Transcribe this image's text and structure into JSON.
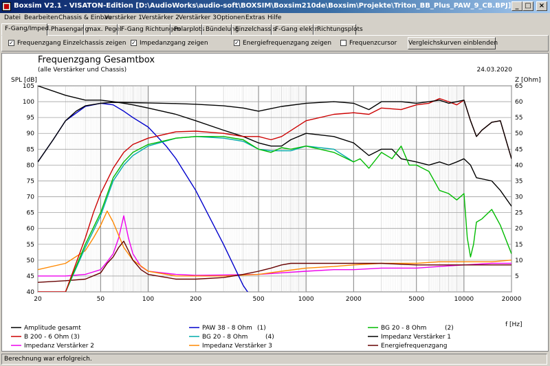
{
  "window": {
    "title": "Boxsim V2.1 - VISATON-Edition [D:\\AudioWorks\\audio-soft\\BOXSIM\\Boxsim210de\\Boxsim\\Projekte\\Triton_BB_Plus_PAW_9_CB.BPJ]",
    "min_icon": "minimize-icon",
    "max_icon": "maximize-icon",
    "close_icon": "close-icon",
    "min_glyph": "_",
    "max_glyph": "□",
    "close_glyph": "×"
  },
  "menu": [
    "Datei",
    "Bearbeiten",
    "Chassis & Einbau",
    "Verstärker 1",
    "Verstärker 2",
    "Verstärker 3",
    "Optionen",
    "Extras",
    "Hilfe"
  ],
  "tabs": [
    "F-Gang/Imped.",
    "Phasengang",
    "max. Pegel",
    "F-Gang Richtungen",
    "Polarplots",
    "Bündelung",
    "Einzelchassis",
    "F-Gang elektr.",
    "Richtungsplots"
  ],
  "options": {
    "check1": "Frequenzgang Einzelchassis zeigen",
    "check2": "Impedanzgang zeigen",
    "check3": "Energiefrequenzgang zeigen",
    "check4": "Frequenzcursor",
    "check_mark": "✓",
    "button": "Vergleichskurven einblenden"
  },
  "status": "Berechnung war erfolgreich.",
  "chart_data": {
    "type": "line",
    "title": "Frequenzgang Gesamtbox",
    "subtitle": "(alle Verstärker und Chassis)",
    "date": "24.03.2020",
    "ylabel": "SPL [dB]",
    "y2label": "Z [Ohm]",
    "xlabel": "f [Hz]",
    "xscale": "log",
    "xlim": [
      20,
      20000
    ],
    "ylim": [
      40,
      105
    ],
    "y2lim": [
      0,
      65
    ],
    "xticks": [
      "20",
      "50",
      "100",
      "200",
      "500",
      "1000",
      "2000",
      "5000",
      "10000",
      "20000"
    ],
    "yticks": [
      "40",
      "45",
      "50",
      "55",
      "60",
      "65",
      "70",
      "75",
      "80",
      "85",
      "90",
      "95",
      "100",
      "105"
    ],
    "y2ticks": [
      "5",
      "10",
      "15",
      "20",
      "25",
      "30",
      "35",
      "40",
      "45",
      "50",
      "55",
      "60",
      "65"
    ],
    "series": [
      {
        "name": "Amplitude gesamt",
        "color": "#000000",
        "axis": "left",
        "x": [
          20,
          25,
          30,
          35,
          40,
          50,
          60,
          80,
          100,
          150,
          200,
          300,
          400,
          500,
          700,
          1000,
          1500,
          2000,
          2500,
          3000,
          4000,
          5000,
          6000,
          7000,
          8000,
          9000,
          10000,
          11000,
          12000,
          13000,
          15000,
          17000,
          20000
        ],
        "y": [
          81,
          88,
          94,
          97,
          98.7,
          99.5,
          99.8,
          99.7,
          99.6,
          99.4,
          99.2,
          98.7,
          98,
          97,
          98.5,
          99.5,
          100,
          99.5,
          97.5,
          100,
          100,
          99.5,
          100,
          100.5,
          99.5,
          100,
          100.5,
          94,
          89,
          91,
          93.5,
          94,
          82
        ]
      },
      {
        "name": "B 200 - 6 Ohm (3)",
        "color": "#cc0000",
        "axis": "left",
        "x": [
          20,
          30,
          40,
          45,
          50,
          60,
          70,
          80,
          100,
          150,
          200,
          300,
          400,
          500,
          600,
          700,
          1000,
          1500,
          2000,
          2500,
          3000,
          4000,
          5000,
          6000,
          7000,
          8000,
          9000,
          10000,
          11000,
          12000,
          13000,
          15000,
          17000,
          20000
        ],
        "y": [
          40,
          40,
          57,
          65,
          71,
          79,
          84,
          86.5,
          88.5,
          90.5,
          90.7,
          90,
          89,
          89,
          88,
          89,
          94,
          96,
          96.5,
          96,
          98,
          97.5,
          99,
          99.5,
          101,
          100,
          99,
          100.5,
          94,
          89,
          91,
          93.5,
          94,
          82
        ]
      },
      {
        "name": "BG 20 - 8 Ohm (2)",
        "color": "#00bb00",
        "axis": "left",
        "x": [
          30,
          40,
          50,
          60,
          70,
          80,
          100,
          150,
          200,
          300,
          400,
          500,
          600,
          700,
          800,
          1000,
          1500,
          2000,
          2200,
          2500,
          3000,
          3500,
          4000,
          4500,
          5000,
          6000,
          7000,
          8000,
          9000,
          10000,
          10500,
          11000,
          11500,
          12000,
          13000,
          15000,
          17000,
          20000
        ],
        "y": [
          40,
          55,
          65,
          76,
          81,
          84,
          86.5,
          88.5,
          89,
          89,
          88,
          85,
          84,
          85.5,
          85,
          86,
          84,
          81,
          82,
          79,
          84,
          82,
          86,
          80,
          80,
          78,
          72,
          71,
          69,
          71,
          57,
          51,
          55,
          62,
          63,
          66,
          61,
          52
        ]
      },
      {
        "name": "BG 20 - 8 Ohm (4)",
        "color": "#00aaaa",
        "axis": "left",
        "x": [
          30,
          40,
          50,
          60,
          70,
          80,
          100,
          150,
          200,
          300,
          400,
          500,
          600,
          700,
          800,
          1000,
          1500,
          2000
        ],
        "y": [
          40,
          54,
          64,
          75,
          80,
          83,
          86,
          88.5,
          89,
          88.5,
          87.5,
          85,
          84.5,
          84.5,
          84.5,
          86,
          85,
          81
        ]
      },
      {
        "name": "PAW 38 - 8 Ohm (1)",
        "color": "#0000cc",
        "axis": "left",
        "x": [
          20,
          25,
          30,
          40,
          50,
          60,
          70,
          80,
          100,
          130,
          150,
          200,
          300,
          400,
          500
        ],
        "y": [
          81,
          88,
          94,
          98.5,
          99.5,
          99,
          97,
          95,
          92,
          86,
          82,
          72,
          55,
          42,
          35
        ]
      },
      {
        "name": "Impedanz Verstärker 1",
        "color": "#000000",
        "axis": "right",
        "x": [
          20,
          30,
          40,
          50,
          60,
          70,
          80,
          100,
          150,
          200,
          300,
          400,
          500,
          600,
          700,
          800,
          1000,
          1500,
          2000,
          2500,
          3000,
          3500,
          4000,
          5000,
          6000,
          7000,
          8000,
          9000,
          10000,
          11000,
          12000,
          15000,
          17000,
          20000
        ],
        "y": [
          65,
          62,
          60.5,
          60.5,
          60,
          59.5,
          59,
          58,
          56,
          54,
          51,
          49,
          47,
          46,
          46,
          48,
          50,
          49,
          47,
          43,
          45,
          45,
          42,
          41,
          40,
          41,
          40,
          41,
          42,
          40,
          36,
          35,
          32,
          27
        ]
      },
      {
        "name": "Impedanz Verstärker 2",
        "color": "#ee00ee",
        "axis": "right",
        "x": [
          20,
          30,
          40,
          50,
          55,
          60,
          65,
          70,
          75,
          80,
          90,
          100,
          150,
          200,
          300,
          500,
          700,
          1000,
          1500,
          2000,
          3000,
          5000,
          7000,
          10000,
          15000,
          20000
        ],
        "y": [
          5,
          5,
          5.5,
          7,
          9.5,
          12,
          17,
          24,
          17,
          12,
          8,
          6.5,
          5.5,
          5.2,
          5.3,
          5.5,
          6,
          6.5,
          7,
          7,
          7.5,
          7.5,
          8,
          8.5,
          9,
          9
        ]
      },
      {
        "name": "Impedanz Verstärker 3",
        "color": "#ff8800",
        "axis": "right",
        "x": [
          20,
          30,
          40,
          45,
          50,
          55,
          60,
          70,
          80,
          100,
          150,
          200,
          300,
          500,
          700,
          1000,
          1500,
          2000,
          3000,
          5000,
          7000,
          10000,
          15000,
          20000
        ],
        "y": [
          7,
          9,
          13,
          17,
          21,
          25.5,
          22,
          14,
          10,
          6.5,
          5,
          5,
          5,
          5.5,
          6.5,
          7.5,
          8,
          8.5,
          9,
          9,
          9.5,
          9.5,
          9.5,
          10
        ]
      },
      {
        "name": "Energiefrequenzgang",
        "color": "#660000",
        "axis": "right",
        "x": [
          20,
          30,
          40,
          50,
          55,
          60,
          65,
          70,
          75,
          80,
          90,
          100,
          150,
          200,
          300,
          400,
          500,
          600,
          700,
          800,
          1000,
          1500,
          2000,
          3000,
          5000,
          7000,
          10000,
          15000,
          20000
        ],
        "y": [
          3,
          3.5,
          4,
          6,
          9,
          11,
          14,
          16,
          13,
          10,
          7,
          5.5,
          4,
          4,
          4.5,
          5.5,
          6.5,
          7.5,
          8.5,
          9,
          9,
          9,
          9,
          9,
          8.5,
          8.5,
          8.5,
          8.5,
          8.5
        ]
      }
    ]
  },
  "legend_rows": [
    [
      "Amplitude gesamt",
      "PAW 38 - 8 Ohm",
      "(1)",
      "BG 20 - 8 Ohm",
      "(2)"
    ],
    [
      "B 200 - 6 Ohm (3)",
      "BG 20 - 8 Ohm",
      "(4)",
      "Impedanz Verstärker 1"
    ],
    [
      "Impedanz Verstärker 2",
      "Impedanz Verstärker 3",
      "Energiefrequenzgang"
    ]
  ]
}
